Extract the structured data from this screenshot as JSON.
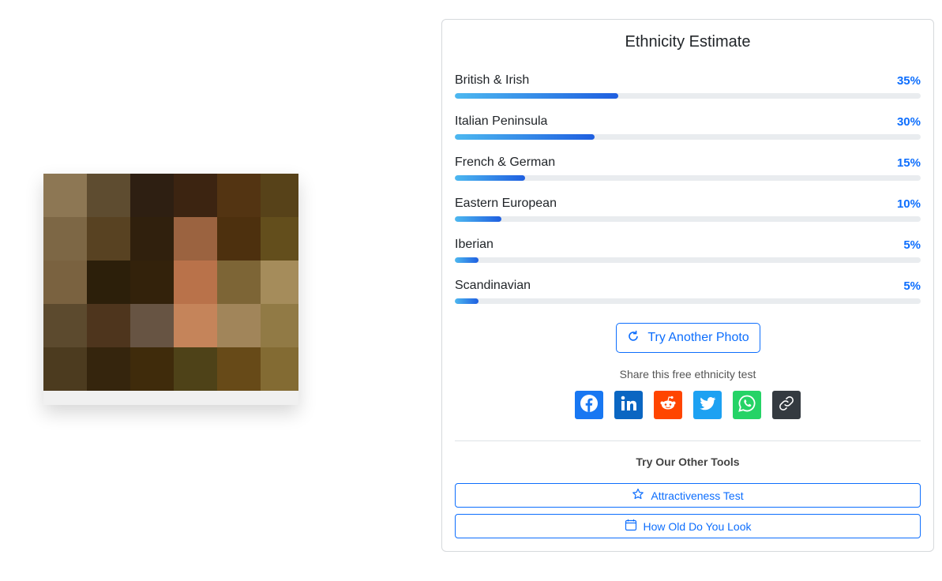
{
  "photo": {
    "mosaic_colors": [
      "#8d7754",
      "#5e4c30",
      "#2e1f12",
      "#3c2411",
      "#533412",
      "#574219",
      "#7d6745",
      "#584222",
      "#30200d",
      "#9b6340",
      "#4d300e",
      "#634e1c",
      "#7a6240",
      "#2c1f0a",
      "#33220b",
      "#b9724a",
      "#7d6536",
      "#a58c5b",
      "#5c4a2e",
      "#4e351d",
      "#675443",
      "#c5845a",
      "#a1855a",
      "#917a45",
      "#4c3b1f",
      "#35250d",
      "#3f2b0b",
      "#4e4218",
      "#674a18",
      "#836b33"
    ]
  },
  "card": {
    "title": "Ethnicity Estimate",
    "ethnicities": [
      {
        "name": "British & Irish",
        "percent_label": "35%",
        "percent": 35
      },
      {
        "name": "Italian Peninsula",
        "percent_label": "30%",
        "percent": 30
      },
      {
        "name": "French & German",
        "percent_label": "15%",
        "percent": 15
      },
      {
        "name": "Eastern European",
        "percent_label": "10%",
        "percent": 10
      },
      {
        "name": "Iberian",
        "percent_label": "5%",
        "percent": 5
      },
      {
        "name": "Scandinavian",
        "percent_label": "5%",
        "percent": 5
      }
    ],
    "retry_label": "Try Another Photo",
    "retry_icon": "refresh-icon",
    "share_label": "Share this free ethnicity test",
    "share_buttons": [
      {
        "name": "facebook",
        "icon": "facebook-icon",
        "color": "#1877f2"
      },
      {
        "name": "linkedin",
        "icon": "linkedin-icon",
        "color": "#0a66c2"
      },
      {
        "name": "reddit",
        "icon": "reddit-icon",
        "color": "#ff4500"
      },
      {
        "name": "twitter",
        "icon": "twitter-icon",
        "color": "#1da1f2"
      },
      {
        "name": "whatsapp",
        "icon": "whatsapp-icon",
        "color": "#25d366"
      },
      {
        "name": "copy-link",
        "icon": "link-icon",
        "color": "#343a40"
      }
    ],
    "tools_title": "Try Our Other Tools",
    "tools": [
      {
        "label": "Attractiveness Test",
        "icon": "star-icon"
      },
      {
        "label": "How Old Do You Look",
        "icon": "calendar-icon"
      }
    ]
  },
  "colors": {
    "accent": "#0d6efd",
    "bar_start": "#4db8f0",
    "bar_end": "#1f5fe0",
    "track": "#e9ecef"
  }
}
